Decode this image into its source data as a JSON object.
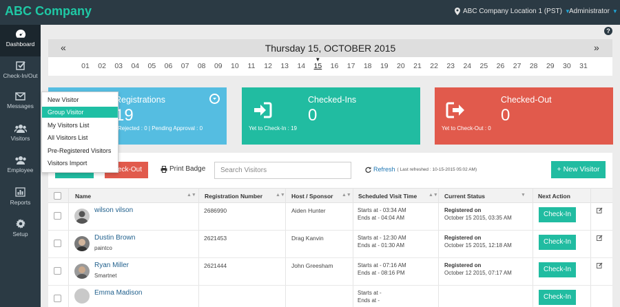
{
  "header": {
    "brand": "ABC Company",
    "location": "ABC Company Location 1 (PST)",
    "user": "Administrator"
  },
  "sidebar": {
    "items": [
      {
        "label": "Dashboard",
        "icon": "dashboard-icon",
        "active": true
      },
      {
        "label": "Check-In/Out",
        "icon": "checkbox-icon"
      },
      {
        "label": "Messages",
        "icon": "envelope-icon"
      },
      {
        "label": "Visitors",
        "icon": "users-icon"
      },
      {
        "label": "Employee",
        "icon": "users-icon"
      },
      {
        "label": "Reports",
        "icon": "bar-chart-icon"
      },
      {
        "label": "Setup",
        "icon": "gear-icon"
      }
    ]
  },
  "datebar": {
    "title": "Thursday 15, OCTOBER 2015",
    "prev": "«",
    "next": "»",
    "days": [
      "01",
      "02",
      "03",
      "04",
      "05",
      "06",
      "07",
      "08",
      "09",
      "10",
      "11",
      "12",
      "13",
      "14",
      "15",
      "16",
      "17",
      "18",
      "19",
      "20",
      "21",
      "22",
      "23",
      "24",
      "25",
      "26",
      "27",
      "28",
      "29",
      "30",
      "31"
    ],
    "selected": "15"
  },
  "cards": {
    "registrations": {
      "title": "Registrations",
      "value": "19",
      "sub": "Rejected : 0 | Pending Approval : 0"
    },
    "checkedins": {
      "title": "Checked-Ins",
      "value": "0",
      "sub": "Yet to Check-In : 19"
    },
    "checkedout": {
      "title": "Checked-Out",
      "value": "0",
      "sub": "Yet to Check-Out : 0"
    }
  },
  "toolbar": {
    "checkout_label": "Check-Out",
    "print_label": "Print Badge",
    "search_placeholder": "Search Visitors",
    "refresh_label": "Refresh",
    "refresh_note": "( Last refreshed : 10-15-2015 05:02 AM)",
    "new_visitor_label": "+ New Visitor"
  },
  "table": {
    "headers": [
      "Name",
      "Registration Number",
      "Host / Sponsor",
      "Scheduled Visit Time",
      "Current Status",
      "Next Action"
    ],
    "rows": [
      {
        "name": "wilson vilson",
        "sub": "",
        "reg": "2686990",
        "host": "Aiden Hunter",
        "start": "Starts at - 03:34 AM",
        "end": "Ends at - 04:04 AM",
        "status1": "Registered on",
        "status2": "October 15 2015, 03:35 AM",
        "action": "Check-In"
      },
      {
        "name": "Dustin Brown",
        "sub": "paintco",
        "reg": "2621453",
        "host": "Drag Kanvin",
        "start": "Starts at - 12:30 AM",
        "end": "Ends at - 01:30 AM",
        "status1": "Registered on",
        "status2": "October 15 2015, 12:18 AM",
        "action": "Check-In"
      },
      {
        "name": "Ryan Miller",
        "sub": "Smartnet",
        "reg": "2621444",
        "host": "John Greesham",
        "start": "Starts at - 07:16 AM",
        "end": "Ends at - 08:16 PM",
        "status1": "Registered on",
        "status2": "October 12 2015, 07:17 AM",
        "action": "Check-In"
      },
      {
        "name": "Emma Madison",
        "sub": "",
        "reg": "",
        "host": "",
        "start": "Starts at -",
        "end": "Ends at -",
        "status1": "",
        "status2": "",
        "action": "Check-In"
      }
    ]
  },
  "menu": {
    "items": [
      "New Visitor",
      "Group Visitor",
      "My Visitors List",
      "All Visitors List",
      "Pre-Registered Visitors",
      "Visitors Import"
    ],
    "active": "Group Visitor"
  },
  "colors": {
    "accent": "#21bca1",
    "blue": "#55bde1",
    "red": "#e15a4c",
    "nav": "#2b3a44"
  }
}
